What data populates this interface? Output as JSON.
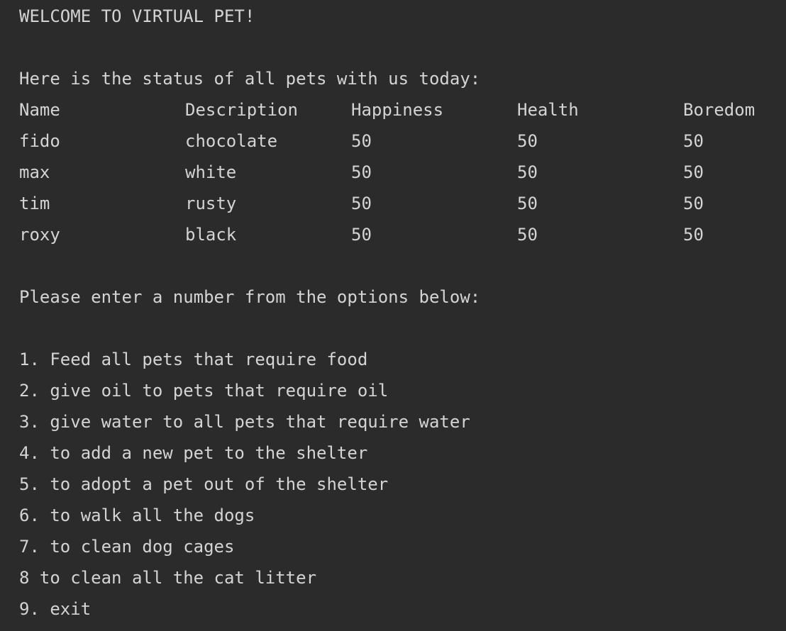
{
  "welcome": "WELCOME TO VIRTUAL PET!",
  "status_intro": "Here is the status of all pets with us today:",
  "table": {
    "headers": [
      "Name",
      "Description",
      "Happiness",
      "Health",
      "Boredom"
    ],
    "rows": [
      [
        "fido",
        "chocolate",
        "50",
        "50",
        "50"
      ],
      [
        "max",
        "white",
        "50",
        "50",
        "50"
      ],
      [
        "tim",
        "rusty",
        "50",
        "50",
        "50"
      ],
      [
        "roxy",
        "black",
        "50",
        "50",
        "50"
      ]
    ]
  },
  "prompt": "Please enter a number from the options below:",
  "options": [
    "1. Feed all pets that require food",
    "2. give oil to pets that require oil",
    "3. give water to all pets that require water",
    "4. to add a new pet to the shelter",
    "5. to adopt a pet out of the shelter",
    "6. to walk all the dogs",
    "7. to clean dog cages",
    "8 to clean all the cat litter",
    "9. exit"
  ]
}
